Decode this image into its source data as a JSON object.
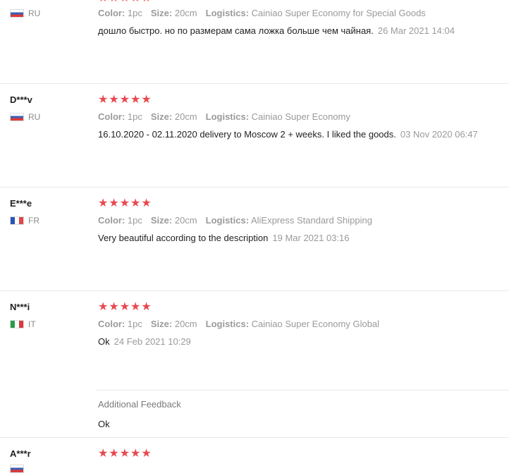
{
  "reviews": [
    {
      "name": "",
      "country": "RU",
      "flag": "ru",
      "stars": "★★★★★",
      "color_label": "Color:",
      "color": "1pc",
      "size_label": "Size:",
      "size": "20cm",
      "logistics_label": "Logistics:",
      "logistics": "Cainiao Super Economy for Special Goods",
      "text": "дошло быстро. но по размерам сама ложка больше чем чайная.",
      "time": "26 Mar 2021 14:04"
    },
    {
      "name": "D***v",
      "country": "RU",
      "flag": "ru",
      "stars": "★★★★★",
      "color_label": "Color:",
      "color": "1pc",
      "size_label": "Size:",
      "size": "20cm",
      "logistics_label": "Logistics:",
      "logistics": "Cainiao Super Economy",
      "text": "16.10.2020 - 02.11.2020 delivery to Moscow 2 + weeks. I liked the goods.",
      "time": "03 Nov 2020 06:47"
    },
    {
      "name": "E***e",
      "country": "FR",
      "flag": "fr",
      "stars": "★★★★★",
      "color_label": "Color:",
      "color": "1pc",
      "size_label": "Size:",
      "size": "20cm",
      "logistics_label": "Logistics:",
      "logistics": "AliExpress Standard Shipping",
      "text": "Very beautiful according to the description",
      "time": "19 Mar 2021 03:16"
    },
    {
      "name": "N***i",
      "country": "IT",
      "flag": "it",
      "stars": "★★★★★",
      "color_label": "Color:",
      "color": "1pc",
      "size_label": "Size:",
      "size": "20cm",
      "logistics_label": "Logistics:",
      "logistics": "Cainiao Super Economy Global",
      "text": "Ok",
      "time": "24 Feb 2021 10:29",
      "additional_title": "Additional Feedback",
      "additional_text": "Ok"
    },
    {
      "name": "A***r",
      "stars": "★★★★★"
    }
  ]
}
